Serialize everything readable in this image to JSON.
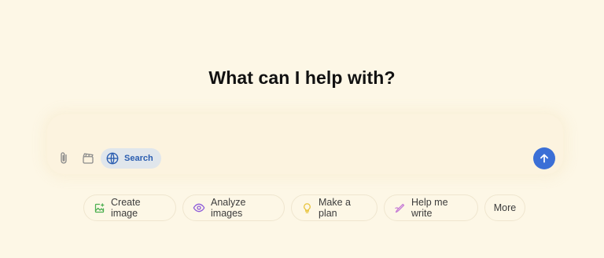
{
  "heading": "What can I help with?",
  "composer": {
    "attach_icon": "paperclip-icon",
    "tools_icon": "clapperboard-icon",
    "search_label": "Search",
    "search_icon": "globe-icon",
    "send_icon": "arrow-up-icon"
  },
  "suggestions": [
    {
      "label": "Create image",
      "icon": "image-icon",
      "color": "#4caf50"
    },
    {
      "label": "Analyze images",
      "icon": "eye-icon",
      "color": "#8e5cd9"
    },
    {
      "label": "Make a plan",
      "icon": "lightbulb-icon",
      "color": "#e8c33a"
    },
    {
      "label": "Help me write",
      "icon": "pen-icon",
      "color": "#c77dd6"
    },
    {
      "label": "More",
      "icon": "",
      "color": ""
    }
  ],
  "colors": {
    "background": "#fdf7e6",
    "accent": "#3b6fd6",
    "search_pill_bg": "#e0e6ec",
    "search_text": "#2a5db0"
  }
}
